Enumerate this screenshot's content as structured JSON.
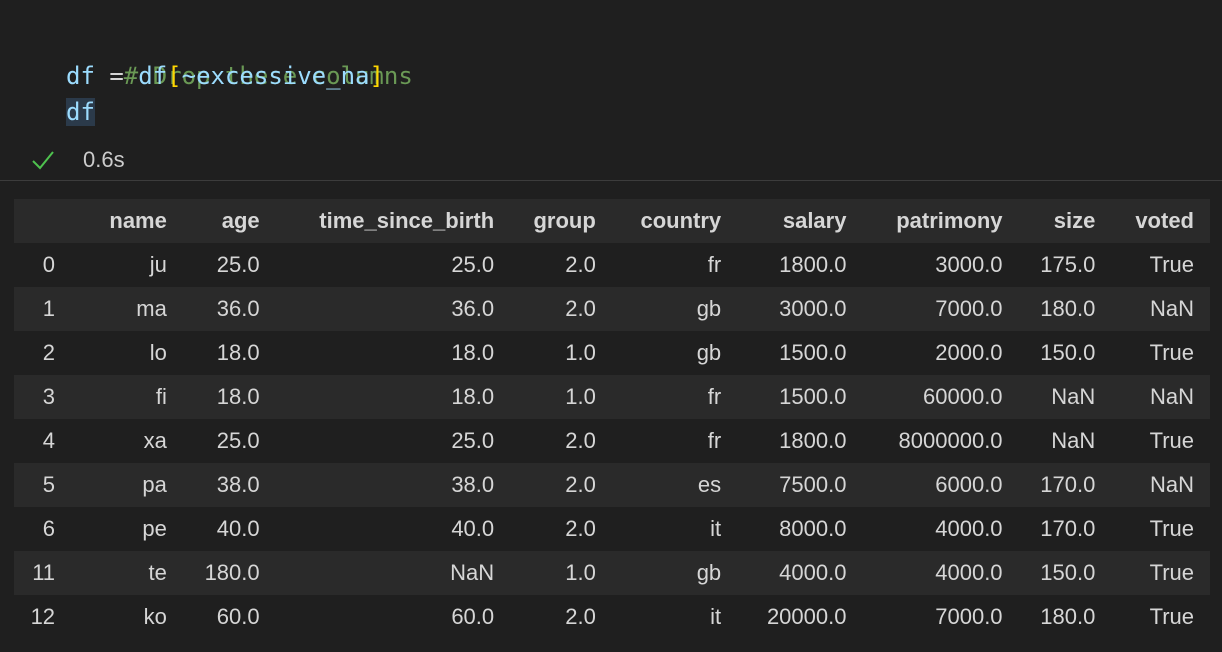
{
  "code": {
    "comment": "# Drop these columns",
    "line2": {
      "lhs": "df",
      "op": " = ",
      "obj": "df",
      "open_bracket": "[",
      "expr": "~excessive_na",
      "close_bracket": "]"
    },
    "line3": "df"
  },
  "execution": {
    "status_icon": "check-icon",
    "status_color": "#4ec24e",
    "time": "0.6s"
  },
  "table": {
    "columns": [
      "",
      "name",
      "age",
      "time_since_birth",
      "group",
      "country",
      "salary",
      "patrimony",
      "size",
      "voted"
    ],
    "rows": [
      [
        "0",
        "ju",
        "25.0",
        "25.0",
        "2.0",
        "fr",
        "1800.0",
        "3000.0",
        "175.0",
        "True"
      ],
      [
        "1",
        "ma",
        "36.0",
        "36.0",
        "2.0",
        "gb",
        "3000.0",
        "7000.0",
        "180.0",
        "NaN"
      ],
      [
        "2",
        "lo",
        "18.0",
        "18.0",
        "1.0",
        "gb",
        "1500.0",
        "2000.0",
        "150.0",
        "True"
      ],
      [
        "3",
        "fi",
        "18.0",
        "18.0",
        "1.0",
        "fr",
        "1500.0",
        "60000.0",
        "NaN",
        "NaN"
      ],
      [
        "4",
        "xa",
        "25.0",
        "25.0",
        "2.0",
        "fr",
        "1800.0",
        "8000000.0",
        "NaN",
        "True"
      ],
      [
        "5",
        "pa",
        "38.0",
        "38.0",
        "2.0",
        "es",
        "7500.0",
        "6000.0",
        "170.0",
        "NaN"
      ],
      [
        "6",
        "pe",
        "40.0",
        "40.0",
        "2.0",
        "it",
        "8000.0",
        "4000.0",
        "170.0",
        "True"
      ],
      [
        "11",
        "te",
        "180.0",
        "NaN",
        "1.0",
        "gb",
        "4000.0",
        "4000.0",
        "150.0",
        "True"
      ],
      [
        "12",
        "ko",
        "60.0",
        "60.0",
        "2.0",
        "it",
        "20000.0",
        "7000.0",
        "180.0",
        "True"
      ]
    ]
  }
}
